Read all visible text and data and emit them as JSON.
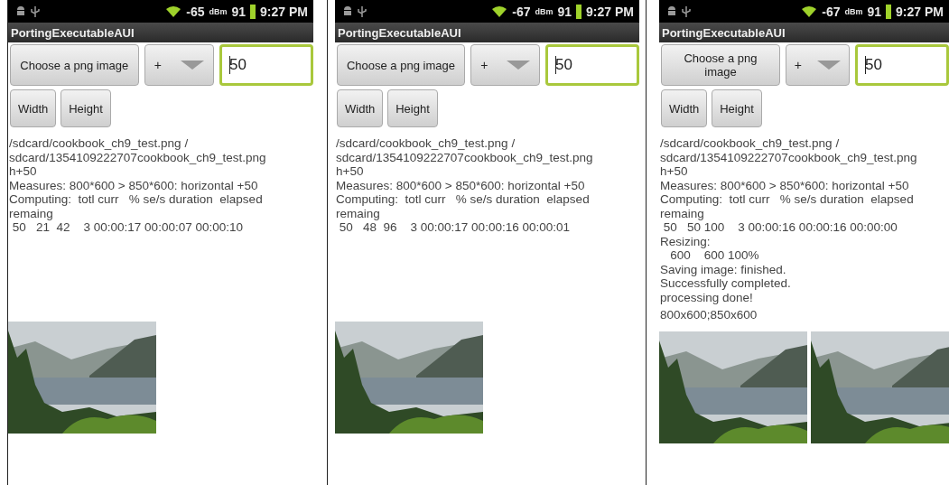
{
  "screens": [
    {
      "status_bar": {
        "signal": "-65",
        "signal_unit": "dBm",
        "battery": "91",
        "time": "9:27 PM"
      },
      "title": "PortingExecutableAUI",
      "choose_button": "Choose a png image",
      "operator_spinner": "+",
      "amount_field": "50",
      "buttons": [
        "Width",
        "Height"
      ],
      "log": [
        "/sdcard/cookbook_ch9_test.png /",
        "sdcard/1354109222707cookbook_ch9_test.png",
        "h+50",
        "Measures: 800*600 > 850*600: horizontal +50",
        "Computing:  totl curr   % se/s duration  elapsed",
        "remaing",
        " 50   21  42    3 00:00:17 00:00:07 00:00:10"
      ],
      "photos": [
        {
          "kind": "landscape"
        }
      ]
    },
    {
      "status_bar": {
        "signal": "-67",
        "signal_unit": "dBm",
        "battery": "91",
        "time": "9:27 PM"
      },
      "title": "PortingExecutableAUI",
      "choose_button": "Choose a png image",
      "operator_spinner": "+",
      "amount_field": "50",
      "buttons": [
        "Width",
        "Height"
      ],
      "log": [
        "/sdcard/cookbook_ch9_test.png /",
        "sdcard/1354109222707cookbook_ch9_test.png",
        "h+50",
        "Measures: 800*600 > 850*600: horizontal +50",
        "Computing:  totl curr   % se/s duration  elapsed",
        "remaing",
        " 50   48  96    3 00:00:17 00:00:16 00:00:01"
      ],
      "photos": [
        {
          "kind": "landscape"
        }
      ]
    },
    {
      "status_bar": {
        "signal": "-67",
        "signal_unit": "dBm",
        "battery": "91",
        "time": "9:27 PM"
      },
      "title": "PortingExecutableAUI",
      "choose_button": "Choose a png image",
      "operator_spinner": "+",
      "amount_field": "50",
      "buttons": [
        "Width",
        "Height"
      ],
      "log": [
        "/sdcard/cookbook_ch9_test.png /",
        "sdcard/1354109222707cookbook_ch9_test.png",
        "h+50",
        "Measures: 800*600 > 850*600: horizontal +50",
        "Computing:  totl curr   % se/s duration  elapsed",
        "remaing",
        " 50   50 100    3 00:00:16 00:00:16 00:00:00",
        "Resizing:",
        "   600    600 100%",
        "Saving image: finished.",
        "Successfully completed.",
        "processing done!"
      ],
      "result": "800x600;850x600",
      "photos": [
        {
          "kind": "landscape"
        },
        {
          "kind": "landscape"
        }
      ]
    }
  ]
}
